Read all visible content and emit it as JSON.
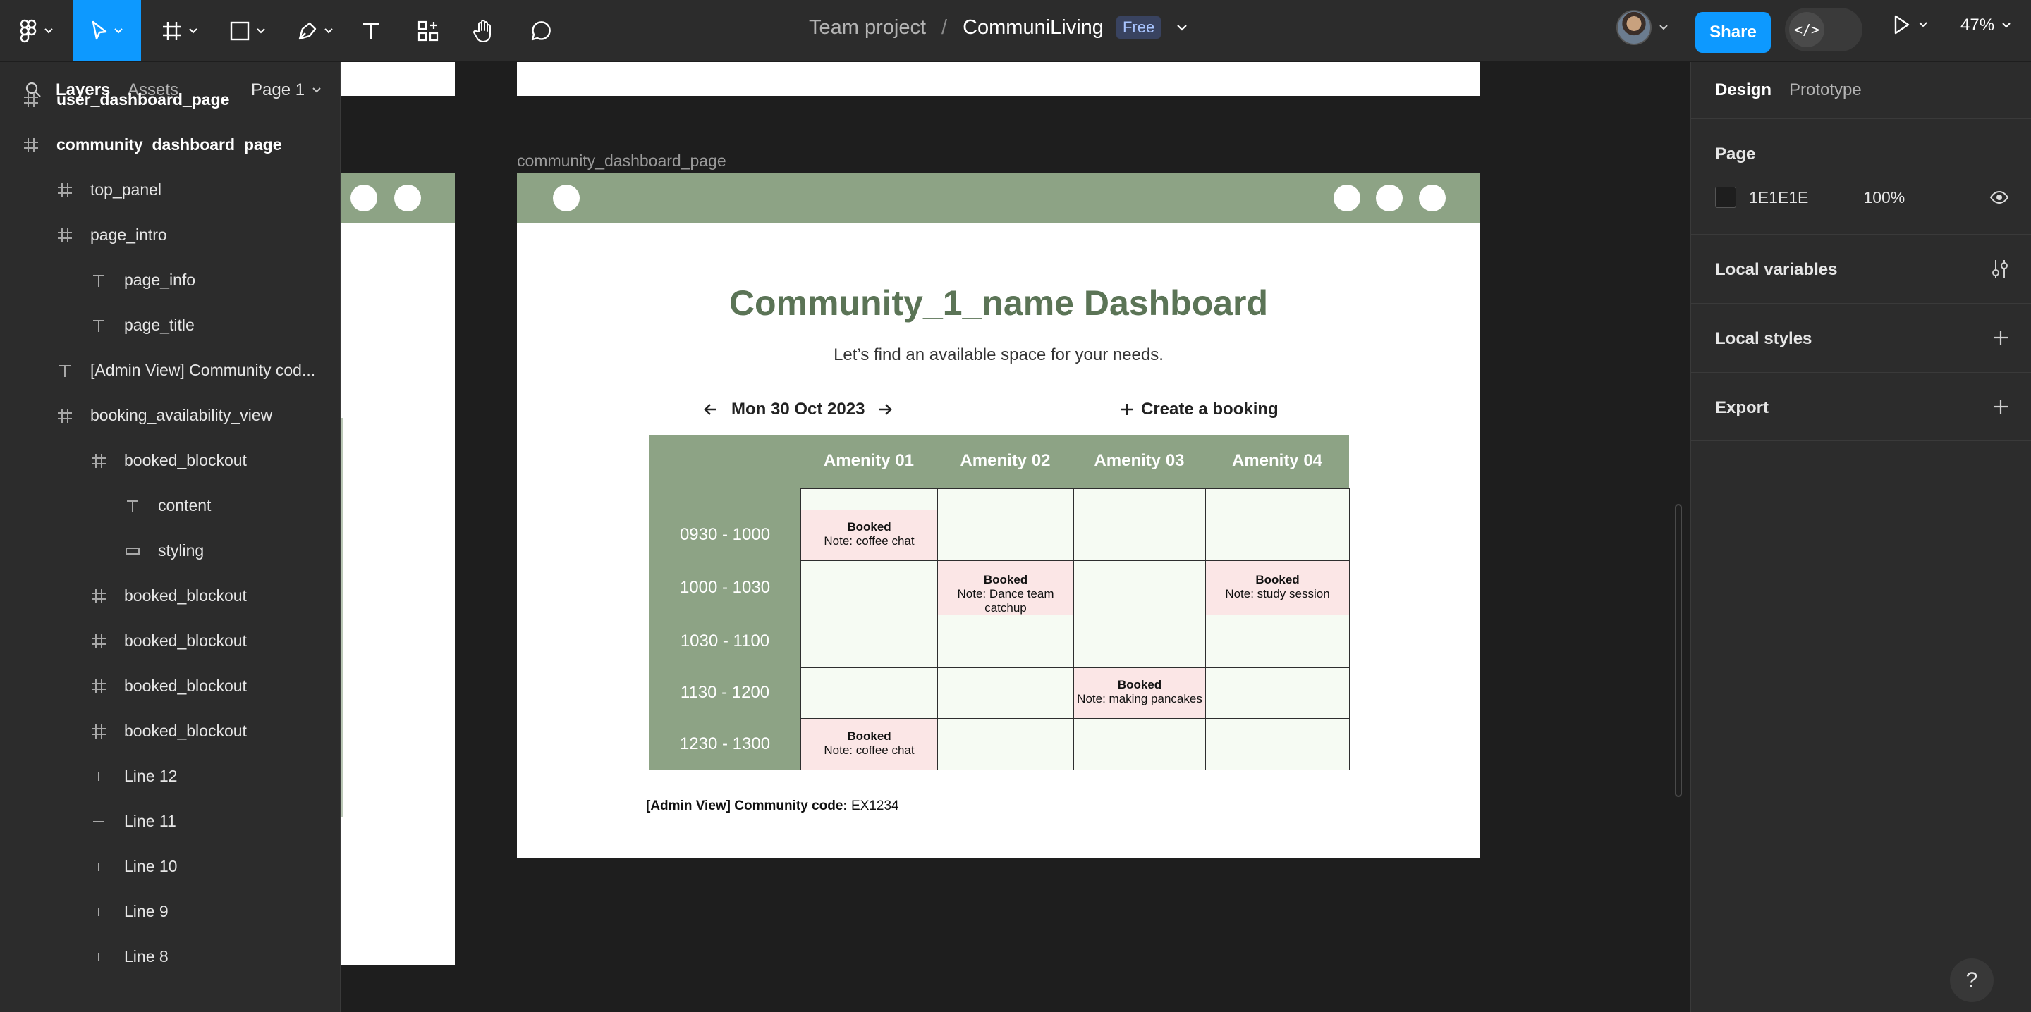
{
  "toolbar": {
    "team": "Team project",
    "separator": "/",
    "project": "CommuniLiving",
    "plan_badge": "Free",
    "share_label": "Share",
    "dev_mode_glyph": "</>",
    "zoom": "47%"
  },
  "left_panel": {
    "tabs": {
      "layers": "Layers",
      "assets": "Assets"
    },
    "page_selector": "Page 1",
    "layers": [
      {
        "label": "user_dashboard_page",
        "icon": "frame-icon",
        "bold": true
      },
      {
        "label": "community_dashboard_page",
        "icon": "frame-icon",
        "bold": true
      },
      {
        "label": "top_panel",
        "icon": "frame-icon"
      },
      {
        "label": "page_intro",
        "icon": "frame-icon"
      },
      {
        "label": "page_info",
        "icon": "text-icon"
      },
      {
        "label": "page_title",
        "icon": "text-icon"
      },
      {
        "label": "[Admin View] Community cod...",
        "icon": "text-icon"
      },
      {
        "label": "booking_availability_view",
        "icon": "frame-icon"
      },
      {
        "label": "booked_blockout",
        "icon": "frame-icon"
      },
      {
        "label": "content",
        "icon": "text-icon"
      },
      {
        "label": "styling",
        "icon": "rectangle-icon"
      },
      {
        "label": "booked_blockout",
        "icon": "frame-icon"
      },
      {
        "label": "booked_blockout",
        "icon": "frame-icon"
      },
      {
        "label": "booked_blockout",
        "icon": "frame-icon"
      },
      {
        "label": "booked_blockout",
        "icon": "frame-icon"
      },
      {
        "label": "Line 12",
        "icon": "vertical-line-icon"
      },
      {
        "label": "Line 11",
        "icon": "horizontal-line-icon"
      },
      {
        "label": "Line 10",
        "icon": "vertical-line-icon"
      },
      {
        "label": "Line 9",
        "icon": "vertical-line-icon"
      },
      {
        "label": "Line 8",
        "icon": "vertical-line-icon"
      }
    ]
  },
  "right_panel": {
    "tabs": {
      "design": "Design",
      "prototype": "Prototype"
    },
    "page_section": {
      "title": "Page",
      "color_hex": "1E1E1E",
      "opacity": "100%"
    },
    "local_variables": "Local variables",
    "local_styles": "Local styles",
    "export": "Export"
  },
  "canvas": {
    "frame_label": "community_dashboard_page",
    "dashboard": {
      "title": "Community_1_name Dashboard",
      "subtitle": "Let’s find an available space for your needs.",
      "date": "Mon 30 Oct 2023",
      "create_booking": "Create a booking",
      "amenities": [
        "Amenity 01",
        "Amenity 02",
        "Amenity 03",
        "Amenity 04"
      ],
      "time_slots": [
        "0930 - 1000",
        "1000 - 1030",
        "1030 - 1100",
        "1130 - 1200",
        "1230 - 1300"
      ],
      "booking_status": "Booked",
      "bookings": [
        {
          "slot": 0,
          "amenity": 0,
          "note": "Note: coffee chat"
        },
        {
          "slot": 1,
          "amenity": 1,
          "note": "Note: Dance team catchup"
        },
        {
          "slot": 1,
          "amenity": 3,
          "note": "Note: study session"
        },
        {
          "slot": 3,
          "amenity": 2,
          "note": "Note: making pancakes"
        },
        {
          "slot": 4,
          "amenity": 0,
          "note": "Note: coffee chat"
        }
      ],
      "admin_label": "[Admin View] Community code:",
      "admin_code": "EX1234"
    }
  },
  "help_label": "?",
  "colors": {
    "accent": "#0d99ff",
    "sage": "#8da385",
    "title_green": "#5b7456",
    "booked_bg": "#fbe6e6",
    "free_bg": "#f6fbf3"
  }
}
